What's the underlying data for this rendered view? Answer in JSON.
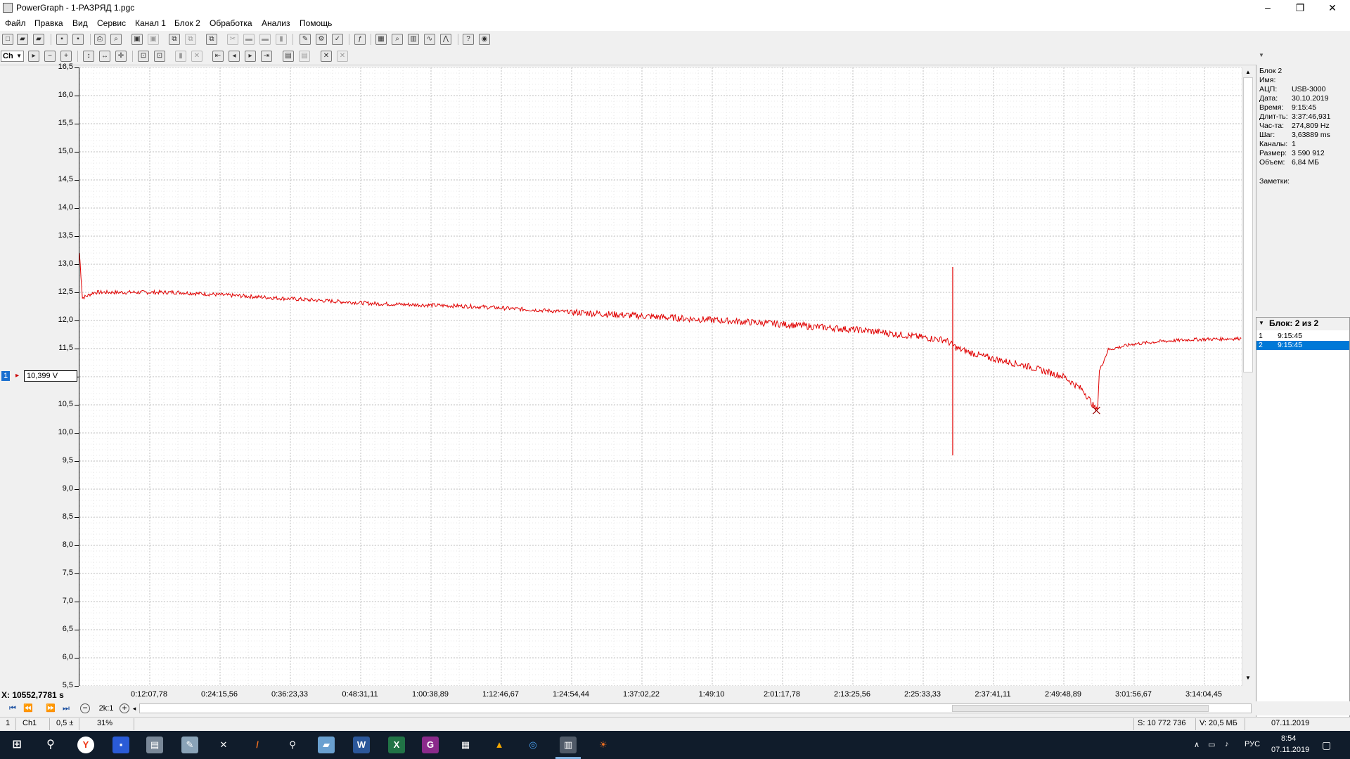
{
  "window": {
    "title": "PowerGraph - 1-РАЗРЯД 1.pgc",
    "minimize": "–",
    "restore": "❐",
    "close": "✕"
  },
  "menu": [
    "Файл",
    "Правка",
    "Вид",
    "Сервис",
    "Канал 1",
    "Блок 2",
    "Обработка",
    "Анализ",
    "Помощь"
  ],
  "toolbar2": {
    "channel_selector": "Ch"
  },
  "chart_data": {
    "type": "line",
    "ylabel": "",
    "xlabel": "",
    "ylim": [
      5.5,
      16.5
    ],
    "y_ticks": [
      "16,5",
      "16,0",
      "15,5",
      "15,0",
      "14,5",
      "14,0",
      "13,5",
      "13,0",
      "12,5",
      "12,0",
      "11,5",
      "11,0",
      "10,5",
      "10,0",
      "9,5",
      "9,0",
      "8,5",
      "8,0",
      "7,5",
      "7,0",
      "6,5",
      "6,0",
      "5,5"
    ],
    "x_tick_labels": [
      "0:12:07,78",
      "0:24:15,56",
      "0:36:23,33",
      "0:48:31,11",
      "1:00:38,89",
      "1:12:46,67",
      "1:24:54,44",
      "1:37:02,22",
      "1:49:10",
      "2:01:17,78",
      "2:13:25,56",
      "2:25:33,33",
      "2:37:41,11",
      "2:49:48,89",
      "3:01:56,67",
      "3:14:04,45"
    ],
    "x_unit": "seconds",
    "xlim": [
      0,
      11827
    ],
    "grid": true,
    "series": [
      {
        "color": "#e00000",
        "points": [
          [
            0,
            13.2
          ],
          [
            30,
            12.4
          ],
          [
            150,
            12.5
          ],
          [
            1000,
            12.5
          ],
          [
            2000,
            12.4
          ],
          [
            3000,
            12.3
          ],
          [
            4000,
            12.25
          ],
          [
            5000,
            12.15
          ],
          [
            6000,
            12.05
          ],
          [
            7000,
            11.95
          ],
          [
            8000,
            11.82
          ],
          [
            8800,
            11.65
          ],
          [
            8920,
            11.5
          ],
          [
            9200,
            11.35
          ],
          [
            9600,
            11.2
          ],
          [
            10000,
            11.0
          ],
          [
            10200,
            10.75
          ],
          [
            10330,
            10.4
          ],
          [
            10345,
            10.55
          ],
          [
            10360,
            11.1
          ],
          [
            10450,
            11.48
          ],
          [
            10700,
            11.58
          ],
          [
            11000,
            11.63
          ],
          [
            11300,
            11.66
          ],
          [
            11800,
            11.68
          ]
        ],
        "spike": {
          "x": 8870,
          "y_min": 9.6,
          "y_max": 12.95
        }
      }
    ],
    "marker": {
      "x": 10330,
      "y": 10.399
    }
  },
  "channel_marker": {
    "number": "1",
    "value": "10,399 V"
  },
  "block_badge": "2",
  "x_readout": "X: 10552,7781 s",
  "info": {
    "title": "Блок 2",
    "rows": [
      {
        "key": "Имя:",
        "value": ""
      },
      {
        "key": "АЦП:",
        "value": "USB-3000"
      },
      {
        "key": "Дата:",
        "value": "30.10.2019"
      },
      {
        "key": "Время:",
        "value": "9:15:45"
      },
      {
        "key": "Длит-ть:",
        "value": "3:37:46,931"
      },
      {
        "key": "Час-та:",
        "value": "274,809 Hz"
      },
      {
        "key": "Шаг:",
        "value": "3,63889 ms"
      },
      {
        "key": "Каналы:",
        "value": "1"
      },
      {
        "key": "Размер:",
        "value": "3 590 912"
      },
      {
        "key": "Объем:",
        "value": "6,84 МБ"
      }
    ],
    "notes_label": "Заметки:"
  },
  "blocks": {
    "header": "Блок: 2 из 2",
    "items": [
      {
        "num": "1",
        "time": "9:15:45",
        "selected": false
      },
      {
        "num": "2",
        "time": "9:15:45",
        "selected": true
      }
    ]
  },
  "nav": {
    "zoom_label": "2k:1"
  },
  "status": {
    "cell1": "1",
    "cell2": "Ch1",
    "cell3": "0,5 ±",
    "cell4": "31%",
    "samples": "S: 10 772 736",
    "volume": "V: 20,5 МБ",
    "date": "07.11.2019"
  },
  "taskbar": {
    "lang": "РУС",
    "time": "8:54",
    "date": "07.11.2019"
  }
}
